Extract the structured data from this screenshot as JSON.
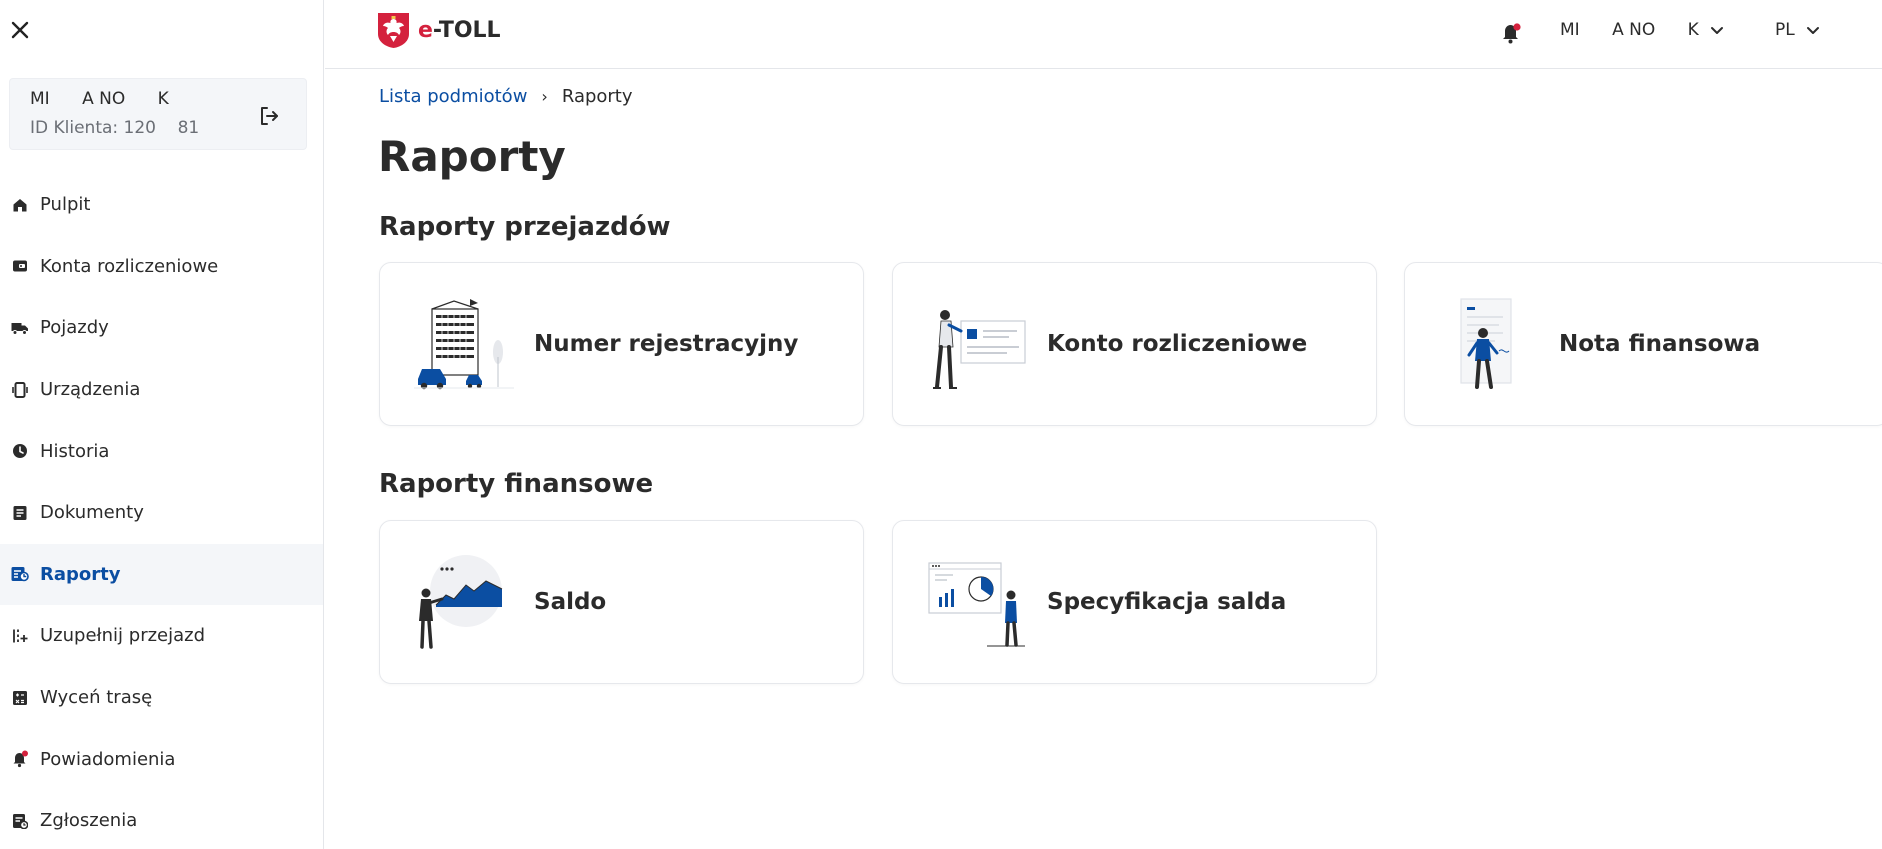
{
  "sidebar": {
    "user": {
      "name": "MI      A NO      K",
      "client_id": "ID Klienta: 120    81"
    },
    "items": [
      {
        "label": "Pulpit",
        "icon": "home-icon"
      },
      {
        "label": "Konta rozliczeniowe",
        "icon": "wallet-icon"
      },
      {
        "label": "Pojazdy",
        "icon": "truck-icon"
      },
      {
        "label": "Urządzenia",
        "icon": "device-icon"
      },
      {
        "label": "Historia",
        "icon": "clock-icon"
      },
      {
        "label": "Dokumenty",
        "icon": "document-icon"
      },
      {
        "label": "Raporty",
        "icon": "report-icon",
        "active": true
      },
      {
        "label": "Uzupełnij przejazd",
        "icon": "route-complete-icon"
      },
      {
        "label": "Wyceń trasę",
        "icon": "calculator-icon"
      },
      {
        "label": "Powiadomienia",
        "icon": "bell-icon"
      },
      {
        "label": "Zgłoszenia",
        "icon": "ticket-icon"
      }
    ]
  },
  "header": {
    "logo_e": "e",
    "logo_rest": "-TOLL",
    "user": "MI      A NO      K",
    "lang": "PL"
  },
  "breadcrumb": {
    "parent": "Lista podmiotów",
    "current": "Raporty"
  },
  "page": {
    "title": "Raporty",
    "section1": "Raporty przejazdów",
    "section2": "Raporty finansowe",
    "cards1": [
      "Numer rejestracyjny",
      "Konto rozliczeniowe",
      "Nota finansowa"
    ],
    "cards2": [
      "Saldo",
      "Specyfikacja salda"
    ]
  },
  "colors": {
    "primary": "#0b4ea2",
    "accent_red": "#d4213d",
    "text": "#2b2b2b",
    "muted": "#6b6f76"
  }
}
